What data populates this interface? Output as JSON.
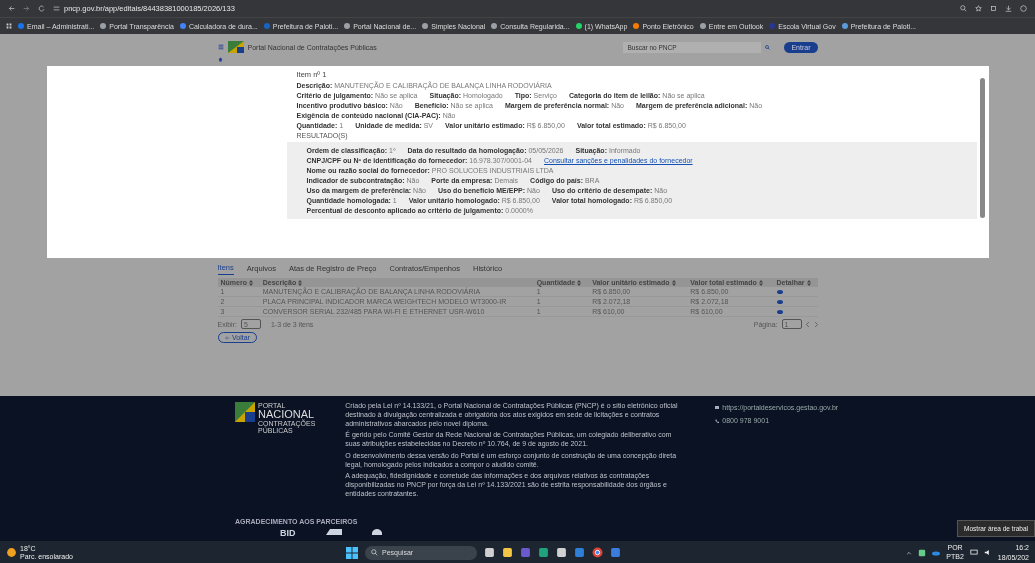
{
  "browser": {
    "url": "pncp.gov.br/app/editais/84438381000185/2026/133",
    "bookmarks": [
      {
        "label": "Email – Administrati...",
        "color": "#1a73e8"
      },
      {
        "label": "Portal Transparência",
        "color": "#9aa0a6"
      },
      {
        "label": "Calculadora de dura...",
        "color": "#4285f4"
      },
      {
        "label": "Prefeitura de Paloti...",
        "color": "#1565c0"
      },
      {
        "label": "Portal Nacional de...",
        "color": "#9aa0a6"
      },
      {
        "label": "Simples Nacional",
        "color": "#9aa0a6"
      },
      {
        "label": "Consulta Regularida...",
        "color": "#9aa0a6"
      },
      {
        "label": "(1) WhatsApp",
        "color": "#25d366"
      },
      {
        "label": "Ponto Eletrônico",
        "color": "#f57c00"
      },
      {
        "label": "Entre em Outlook",
        "color": "#9aa0a6"
      },
      {
        "label": "Escola Virtual Gov",
        "color": "#283593"
      },
      {
        "label": "Prefeitura de Paloti...",
        "color": "#5c9bd6"
      }
    ]
  },
  "header": {
    "title": "Portal Nacional de Contratações Públicas",
    "search_placeholder": "Buscar no PNCP",
    "login": "Entrar"
  },
  "modal": {
    "title": "Item nº 1",
    "rows": [
      [
        {
          "label": "Descrição:",
          "value": "MANUTENÇÃO E CALIBRAÇÃO DE BALANÇA LINHA RODOVIÁRIA"
        }
      ],
      [
        {
          "label": "Critério de julgamento:",
          "value": "Não se aplica"
        },
        {
          "label": "Situação:",
          "value": "Homologado"
        },
        {
          "label": "Tipo:",
          "value": "Serviço"
        },
        {
          "label": "Categoria do item de leilão:",
          "value": "Não se aplica"
        }
      ],
      [
        {
          "label": "Incentivo produtivo básico:",
          "value": "Não"
        },
        {
          "label": "Benefício:",
          "value": "Não se aplica"
        },
        {
          "label": "Margem de preferência normal:",
          "value": "Não"
        },
        {
          "label": "Margem de preferência adicional:",
          "value": "Não"
        }
      ],
      [
        {
          "label": "Exigência de conteúdo nacional (CIA-PAC):",
          "value": "Não"
        }
      ],
      [
        {
          "label": "Quantidade:",
          "value": "1"
        },
        {
          "label": "Unidade de medida:",
          "value": "SV"
        },
        {
          "label": "Valor unitário estimado:",
          "value": "R$ 6.850,00"
        },
        {
          "label": "Valor total estimado:",
          "value": "R$ 6.850,00"
        }
      ]
    ],
    "results_title": "RESULTADO(S)",
    "results": [
      [
        {
          "label": "Ordem de classificação:",
          "value": "1º"
        },
        {
          "label": "Data do resultado da homologação:",
          "value": "05/05/2026"
        },
        {
          "label": "Situação:",
          "value": "Informado"
        }
      ],
      [
        {
          "label": "CNPJ/CPF ou Nº de identificação do fornecedor:",
          "value": "16.978.307/0001-04",
          "link": "Consultar sanções e penalidades do fornecedor"
        }
      ],
      [
        {
          "label": "Nome ou razão social do fornecedor:",
          "value": "PRO SOLUCOES INDUSTRIAIS LTDA"
        }
      ],
      [
        {
          "label": "Indicador de subcontratação:",
          "value": "Não"
        },
        {
          "label": "Porte da empresa:",
          "value": "Demais"
        },
        {
          "label": "Código do país:",
          "value": "BRA"
        }
      ],
      [
        {
          "label": "Uso da margem de preferência:",
          "value": "Não"
        },
        {
          "label": "Uso do benefício ME/EPP:",
          "value": "Não"
        },
        {
          "label": "Uso do critério de desempate:",
          "value": "Não"
        }
      ],
      [
        {
          "label": "Quantidade homologada:",
          "value": "1"
        },
        {
          "label": "Valor unitário homologado:",
          "value": "R$ 6.850,00"
        },
        {
          "label": "Valor total homologado:",
          "value": "R$ 6.850,00"
        }
      ],
      [
        {
          "label": "Percentual de desconto aplicado ao critério de julgamento:",
          "value": "0.0000%"
        }
      ]
    ]
  },
  "tabs": [
    {
      "label": "Itens",
      "selected": true
    },
    {
      "label": "Arquivos",
      "selected": false
    },
    {
      "label": "Atas de Registro de Preço",
      "selected": false
    },
    {
      "label": "Contratos/Empenhos",
      "selected": false
    },
    {
      "label": "Histórico",
      "selected": false
    }
  ],
  "table": {
    "columns": [
      "Número",
      "Descrição",
      "Quantidade",
      "Valor unitário estimado",
      "Valor total estimado",
      "Detalhar"
    ],
    "rows": [
      [
        "1",
        "MANUTENÇÃO E CALIBRAÇÃO DE BALANÇA LINHA RODOVIÁRIA",
        "1",
        "R$ 6.850,00",
        "R$ 6.850,00"
      ],
      [
        "2",
        "PLACA PRINCIPAL INDICADOR MARCA WEIGHTECH MODELO WT3000-IR",
        "1",
        "R$ 2.072,18",
        "R$ 2.072,18"
      ],
      [
        "3",
        "CONVERSOR SERIAL 232/485 PARA WI-FI E ETHERNET USR-W610",
        "1",
        "R$ 610,00",
        "R$ 610,00"
      ]
    ]
  },
  "pagination": {
    "show_label": "Exibir:",
    "page_size": "5",
    "count": "1-3 de 3 itens",
    "page_label": "Página:",
    "page": "1"
  },
  "back_button": "Voltar",
  "footer": {
    "logo_top": "PORTAL",
    "logo_main": "NACIONAL",
    "logo_sub1": "CONTRATAÇÕES",
    "logo_sub2": "PÚBLICAS",
    "paragraphs": [
      "Criado pela Lei nº 14.133/21, o Portal Nacional de Contratações Públicas (PNCP) é o sítio eletrônico oficial destinado à divulgação centralizada e obrigatória dos atos exigidos em sede de licitações e contratos administrativos abarcados pelo novel diploma.",
      "É gerido pelo Comitê Gestor da Rede Nacional de Contratações Públicas, um colegiado deliberativo com suas atribuições estabelecidas no Decreto nº 10.764, de 9 de agosto de 2021.",
      "O desenvolvimento dessa versão do Portal é um esforço conjunto de construção de uma concepção direta legal, homologado pelos indicados a compor o aludido comitê.",
      "A adequação, fidedignidade e corretude das informações e dos arquivos relativos às contratações disponibilizadas no PNCP por força da Lei nº 14.133/2021 são de estrita responsabilidade dos órgãos e entidades contratantes."
    ],
    "site": "https://portaldeservicos.gestao.gov.br",
    "phone": "0800 978 9001",
    "partners_title": "AGRADECIMENTO AOS PARCEIROS",
    "partner": "BID"
  },
  "tooltip": "Mostrar área de trabal",
  "taskbar": {
    "temperature": "18°C",
    "weather": "Parc. ensolarado",
    "search": "Pesquisar",
    "lang": "POR",
    "layout": "PTB2",
    "time": "16:2",
    "date": "18/05/202"
  }
}
